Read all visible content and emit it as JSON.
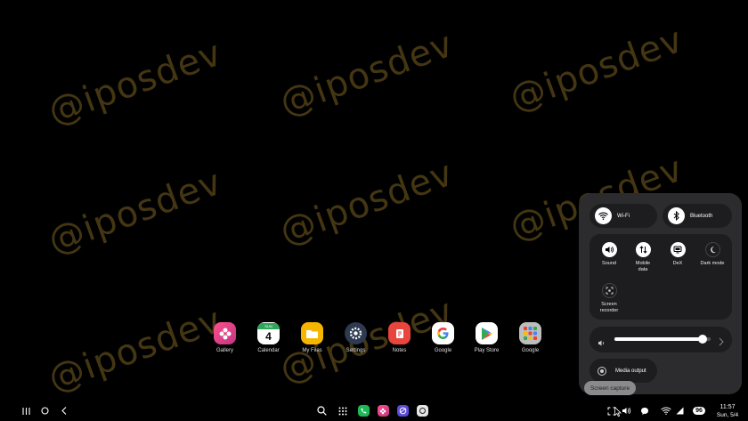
{
  "watermark": {
    "text": "@iposdev"
  },
  "dock": {
    "apps": [
      {
        "label": "Gallery"
      },
      {
        "label": "Calendar",
        "day": "4",
        "month": "SUN"
      },
      {
        "label": "My Files"
      },
      {
        "label": "Settings"
      },
      {
        "label": "Notes"
      },
      {
        "label": "Google"
      },
      {
        "label": "Play Store"
      },
      {
        "label": "Google"
      }
    ]
  },
  "quick_panel": {
    "wifi_label": "Wi-Fi",
    "bluetooth_label": "Bluetooth",
    "tiles": [
      {
        "label": "Sound",
        "active": true
      },
      {
        "label": "Mobile data",
        "active": true
      },
      {
        "label": "DeX",
        "active": true
      },
      {
        "label": "Dark mode",
        "active": false
      },
      {
        "label": "Screen recorder",
        "active": false
      }
    ],
    "brightness_level": 0.92,
    "media_output_label": "Media output"
  },
  "tooltip": {
    "text": "Screen capture"
  },
  "status": {
    "battery": "96",
    "time": "11:57",
    "date": "Sun, 5/4"
  },
  "colors": {
    "accent": "#ffffff",
    "panel": "#2c2c2e",
    "tile_bg": "#1d1d1f"
  }
}
